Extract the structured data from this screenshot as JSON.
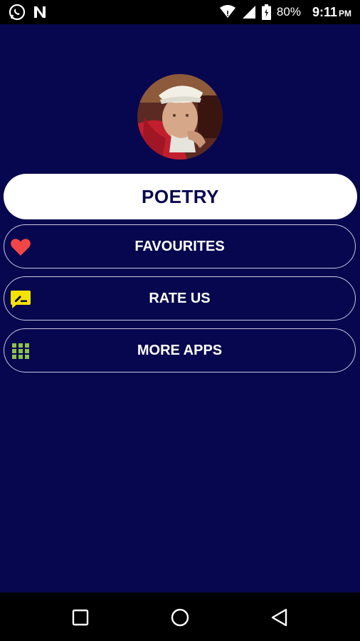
{
  "status_bar": {
    "battery": "80%",
    "time": "9:11",
    "ampm": "PM",
    "icons": [
      "whatsapp-icon",
      "notification-n-icon",
      "wifi-icon",
      "signal-icon",
      "battery-icon"
    ]
  },
  "app": {
    "background": "#07074f",
    "avatar": "poet-avatar",
    "primary_button_label": "POETRY",
    "menu": [
      {
        "label": "FAVOURITES",
        "icon": "heart-icon",
        "icon_color": "#f24646"
      },
      {
        "label": "RATE US",
        "icon": "rate-icon",
        "icon_color": "#f4e200"
      },
      {
        "label": "MORE APPS",
        "icon": "grid-icon",
        "icon_color": "#8bc34a"
      }
    ]
  },
  "nav_bar": {
    "icons": [
      "recent-apps-icon",
      "home-icon",
      "back-icon"
    ]
  }
}
